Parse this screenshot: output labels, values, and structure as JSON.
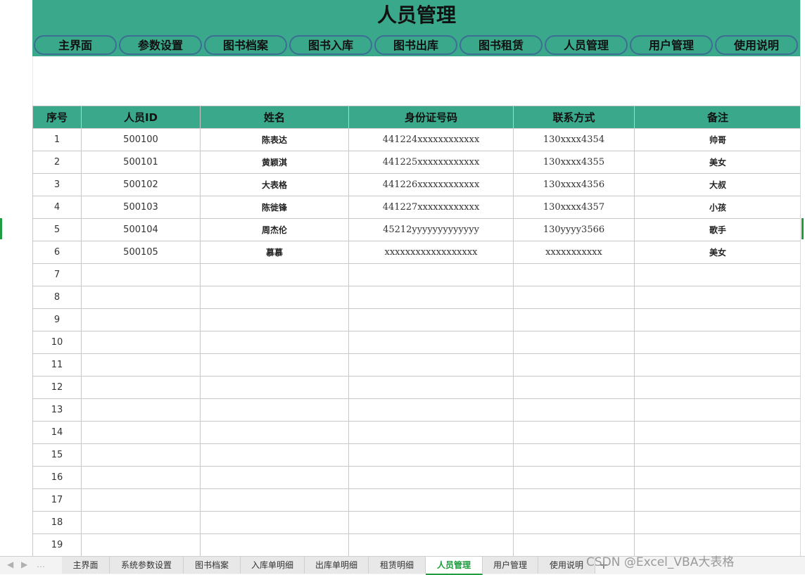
{
  "title": "人员管理",
  "nav": [
    {
      "label": "主界面"
    },
    {
      "label": "参数设置"
    },
    {
      "label": "图书档案"
    },
    {
      "label": "图书入库"
    },
    {
      "label": "图书出库"
    },
    {
      "label": "图书租赁"
    },
    {
      "label": "人员管理"
    },
    {
      "label": "用户管理"
    },
    {
      "label": "使用说明"
    }
  ],
  "table": {
    "headers": [
      "序号",
      "人员ID",
      "姓名",
      "身份证号码",
      "联系方式",
      "备注"
    ],
    "rows": [
      {
        "seq": "1",
        "id": "500100",
        "name": "陈表达",
        "idcard": "441224xxxxxxxxxxxx",
        "contact": "130xxxx4354",
        "note": "帅哥"
      },
      {
        "seq": "2",
        "id": "500101",
        "name": "黄颖淇",
        "idcard": "441225xxxxxxxxxxxx",
        "contact": "130xxxx4355",
        "note": "美女"
      },
      {
        "seq": "3",
        "id": "500102",
        "name": "大表格",
        "idcard": "441226xxxxxxxxxxxx",
        "contact": "130xxxx4356",
        "note": "大叔"
      },
      {
        "seq": "4",
        "id": "500103",
        "name": "陈徙锋",
        "idcard": "441227xxxxxxxxxxxx",
        "contact": "130xxxx4357",
        "note": "小孩"
      },
      {
        "seq": "5",
        "id": "500104",
        "name": "周杰伦",
        "idcard": "45212yyyyyyyyyyyyy",
        "contact": "130yyyy3566",
        "note": "歌手"
      },
      {
        "seq": "6",
        "id": "500105",
        "name": "慕慕",
        "idcard": "xxxxxxxxxxxxxxxxxx",
        "contact": "xxxxxxxxxxx",
        "note": "美女"
      },
      {
        "seq": "7",
        "id": "",
        "name": "",
        "idcard": "",
        "contact": "",
        "note": ""
      },
      {
        "seq": "8",
        "id": "",
        "name": "",
        "idcard": "",
        "contact": "",
        "note": ""
      },
      {
        "seq": "9",
        "id": "",
        "name": "",
        "idcard": "",
        "contact": "",
        "note": ""
      },
      {
        "seq": "10",
        "id": "",
        "name": "",
        "idcard": "",
        "contact": "",
        "note": ""
      },
      {
        "seq": "11",
        "id": "",
        "name": "",
        "idcard": "",
        "contact": "",
        "note": ""
      },
      {
        "seq": "12",
        "id": "",
        "name": "",
        "idcard": "",
        "contact": "",
        "note": ""
      },
      {
        "seq": "13",
        "id": "",
        "name": "",
        "idcard": "",
        "contact": "",
        "note": ""
      },
      {
        "seq": "14",
        "id": "",
        "name": "",
        "idcard": "",
        "contact": "",
        "note": ""
      },
      {
        "seq": "15",
        "id": "",
        "name": "",
        "idcard": "",
        "contact": "",
        "note": ""
      },
      {
        "seq": "16",
        "id": "",
        "name": "",
        "idcard": "",
        "contact": "",
        "note": ""
      },
      {
        "seq": "17",
        "id": "",
        "name": "",
        "idcard": "",
        "contact": "",
        "note": ""
      },
      {
        "seq": "18",
        "id": "",
        "name": "",
        "idcard": "",
        "contact": "",
        "note": ""
      },
      {
        "seq": "19",
        "id": "",
        "name": "",
        "idcard": "",
        "contact": "",
        "note": ""
      }
    ]
  },
  "sheet_tabs": [
    {
      "label": "主界面",
      "active": false
    },
    {
      "label": "系统参数设置",
      "active": false
    },
    {
      "label": "图书档案",
      "active": false
    },
    {
      "label": "入库单明细",
      "active": false
    },
    {
      "label": "出库单明细",
      "active": false
    },
    {
      "label": "租赁明细",
      "active": false
    },
    {
      "label": "人员管理",
      "active": true
    },
    {
      "label": "用户管理",
      "active": false
    },
    {
      "label": "使用说明",
      "active": false
    }
  ],
  "add_sheet_label": "+",
  "watermark": "CSDN @Excel_VBA大表格",
  "colors": {
    "header_green": "#3aa88b",
    "button_border": "#3d6e93",
    "active_tab": "#1f9d3f"
  }
}
